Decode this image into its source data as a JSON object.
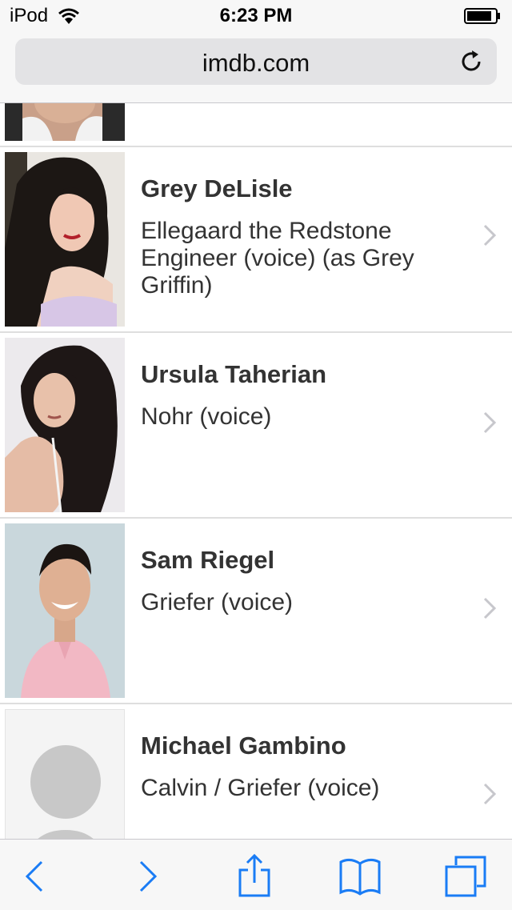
{
  "status_bar": {
    "carrier": "iPod",
    "time": "6:23 PM"
  },
  "address_bar": {
    "url": "imdb.com"
  },
  "cast": [
    {
      "name": "Grey DeLisle",
      "role": "Ellegaard the Redstone Engineer (voice) (as Grey Griffin)"
    },
    {
      "name": "Ursula Taherian",
      "role": "Nohr (voice)"
    },
    {
      "name": "Sam Riegel",
      "role": "Griefer (voice)"
    },
    {
      "name": "Michael Gambino",
      "role": "Calvin / Griefer (voice)"
    }
  ],
  "icons": {
    "wifi": "wifi-icon",
    "battery": "battery-icon",
    "reload": "reload-icon",
    "chevron": "chevron-right-icon",
    "back": "back-icon",
    "forward": "forward-icon",
    "share": "share-icon",
    "bookmarks": "bookmarks-icon",
    "tabs": "tabs-icon"
  },
  "colors": {
    "accent": "#1a7cf5",
    "separator": "#dedede",
    "text": "#333333"
  }
}
